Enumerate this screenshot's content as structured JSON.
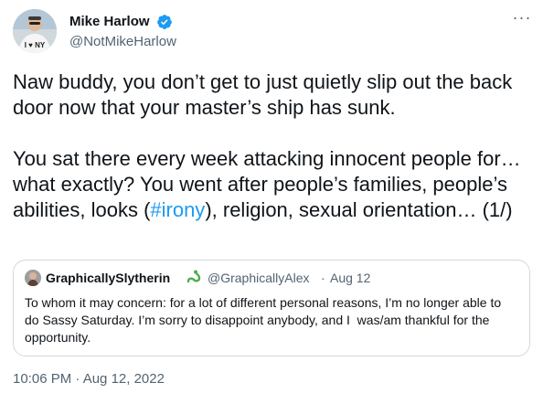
{
  "author": {
    "name": "Mike Harlow",
    "handle": "@NotMikeHarlow",
    "avatar_shirt_text": "I ♥ NY",
    "verified_icon": "verified-badge-icon"
  },
  "menu": {
    "more_label": "···"
  },
  "tweet": {
    "text_before": "Naw buddy, you don’t get to just quietly slip out the back door now that your master’s ship has sunk.\n\nYou sat there every week attacking innocent people for… what exactly? You went after people’s families, people’s abilities, looks (",
    "hashtag": "#irony",
    "text_after": "), religion, sexual orientation… (1/)"
  },
  "quote": {
    "author_name": "GraphicallySlytherin",
    "emoji_icon": "snake-icon",
    "handle": "@GraphicallyAlex",
    "separator": "·",
    "date": "Aug 12",
    "text": "To whom it may concern: for a lot of different personal reasons, I’m no longer able to do Sassy Saturday. I’m sorry to disappoint anybody, and I  was/am thankful for the opportunity."
  },
  "timestamp": "10:06 PM · Aug 12, 2022",
  "colors": {
    "text": "#0f1419",
    "secondary": "#536471",
    "link": "#1d9bf0",
    "border": "#cfd9de",
    "verified": "#1d9bf0",
    "snake": "#4caf50"
  }
}
